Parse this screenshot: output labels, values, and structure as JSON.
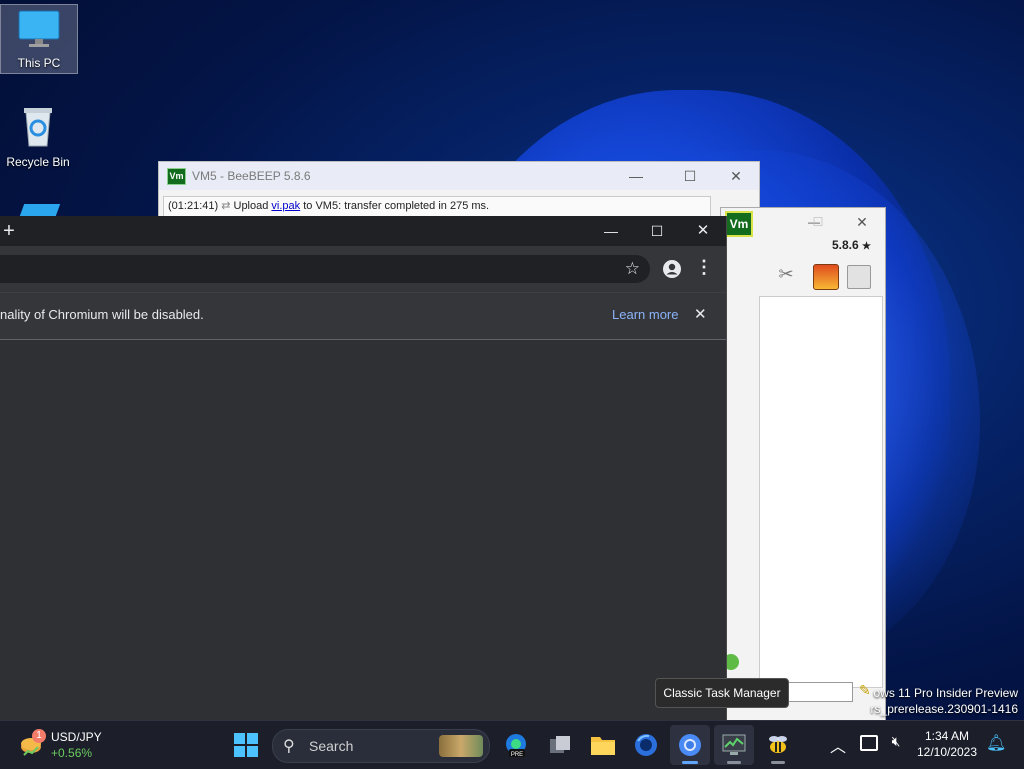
{
  "desktop": {
    "icons": [
      {
        "label": "This PC",
        "icon": "monitor-icon"
      },
      {
        "label": "Recycle Bin",
        "icon": "recycle-bin-icon"
      }
    ],
    "watermark": {
      "line1": "ows 11 Pro Insider Preview",
      "line2": "rs_prerelease.230901-1416"
    }
  },
  "beebeep_back": {
    "logo": "Vm",
    "title": "VM5 - BeeBEEP 5.8.6",
    "log": {
      "time": "(01:21:41)",
      "prefix": "Upload",
      "file": "vi.pak",
      "suffix": "to VM5: transfer completed in 275 ms."
    }
  },
  "beebeep_front": {
    "logo": "Vm",
    "version": "5.8.6"
  },
  "chrome": {
    "new_tab": "+",
    "info_message": "nality of Chromium will be disabled.",
    "learn_more": "Learn more",
    "close_glyph": "✕",
    "star_glyph": "☆",
    "menu_glyph": "⋮"
  },
  "tooltip": "Classic Task Manager",
  "taskbar": {
    "widget": {
      "badge": "1",
      "title": "USD/JPY",
      "change": "+0.56%",
      "change_color": "#6ccb5f"
    },
    "search_label": "Search",
    "apps": [
      "start-icon",
      "copilot-edge-preview-icon",
      "task-view-icon",
      "file-explorer-icon",
      "firefox-icon",
      "chromium-icon",
      "task-manager-icon",
      "beebeep-icon"
    ],
    "clock": {
      "time": "1:34 AM",
      "date": "12/10/2023"
    }
  },
  "colors": {
    "chrome_dark": "#35363a",
    "chrome_link": "#8ab4f8",
    "taskbar": "#1c1f2a",
    "accent": "#60a5fa"
  }
}
